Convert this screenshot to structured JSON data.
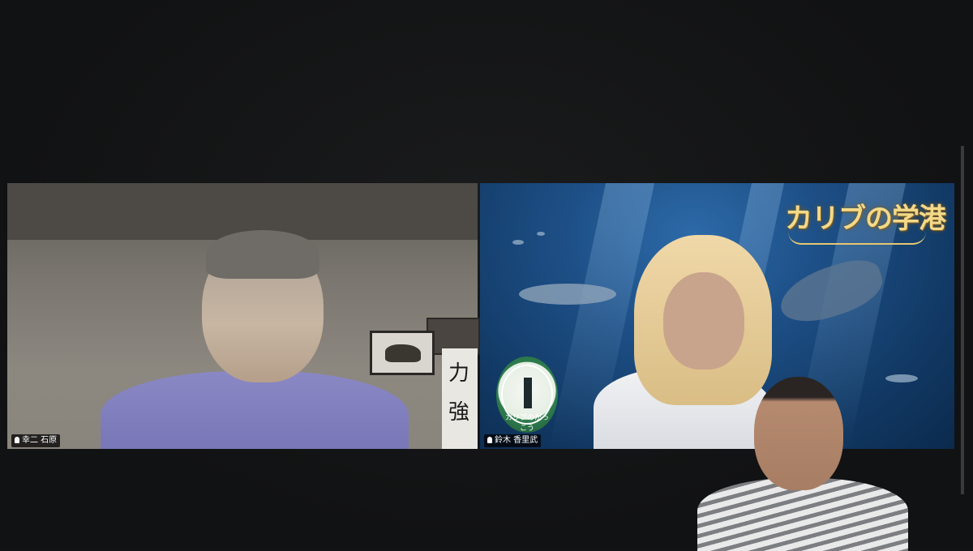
{
  "participants": [
    {
      "name_tag": "幸二 石原"
    },
    {
      "name_tag": "鈴木 香里武"
    }
  ],
  "brand": {
    "logo_text": "カリブの学港"
  },
  "seal": {
    "caption": "カリブのがっこう"
  },
  "scroll": {
    "chars": [
      "力",
      "強"
    ]
  },
  "colors": {
    "background": "#121314",
    "ocean": "#1d4f86",
    "logo_gold": "#f3d98a"
  }
}
